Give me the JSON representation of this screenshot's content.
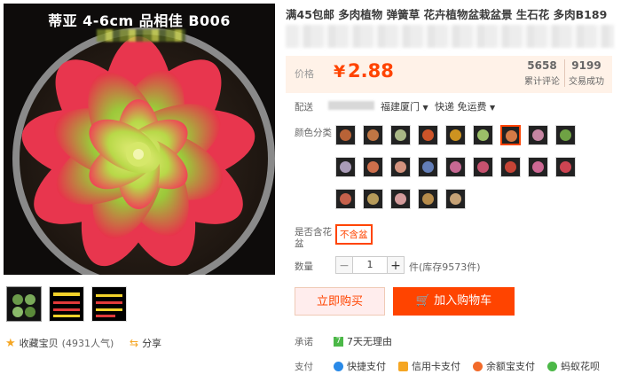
{
  "product": {
    "image_caption": "蒂亚 4-6cm 品相佳 B006",
    "title": "满45包邮 多肉植物 弹簧草 花卉植物盆栽盆景 生石花 多肉B189"
  },
  "price": {
    "label": "价格",
    "currency": "¥",
    "value": "2.88",
    "reviews_count": "5658",
    "reviews_label": "累计评论",
    "sales_count": "9199",
    "sales_label": "交易成功"
  },
  "shipping": {
    "label": "配送",
    "from": "福建厦门",
    "method": "快递 免运费"
  },
  "options": {
    "color_label": "颜色分类",
    "pot_label_line1": "是否含花",
    "pot_label_line2": "盆",
    "pot_value": "不含盆"
  },
  "quantity": {
    "label": "数量",
    "value": "1",
    "minus": "−",
    "plus": "+",
    "stock_text": "件(库存9573件)"
  },
  "actions": {
    "buy_now": "立即购买",
    "add_to_cart": "加入购物车"
  },
  "favorite": {
    "label": "收藏宝贝",
    "count_text": "(4931人气)"
  },
  "share": {
    "label": "分享"
  },
  "promise": {
    "label": "承诺",
    "badge": "7",
    "text": "7天无理由"
  },
  "payment": {
    "label": "支付",
    "methods": [
      "快捷支付",
      "信用卡支付",
      "余额宝支付",
      "蚂蚁花呗"
    ]
  },
  "colors": {
    "accent": "#ff4400",
    "price_bg": "#fff2e8"
  }
}
